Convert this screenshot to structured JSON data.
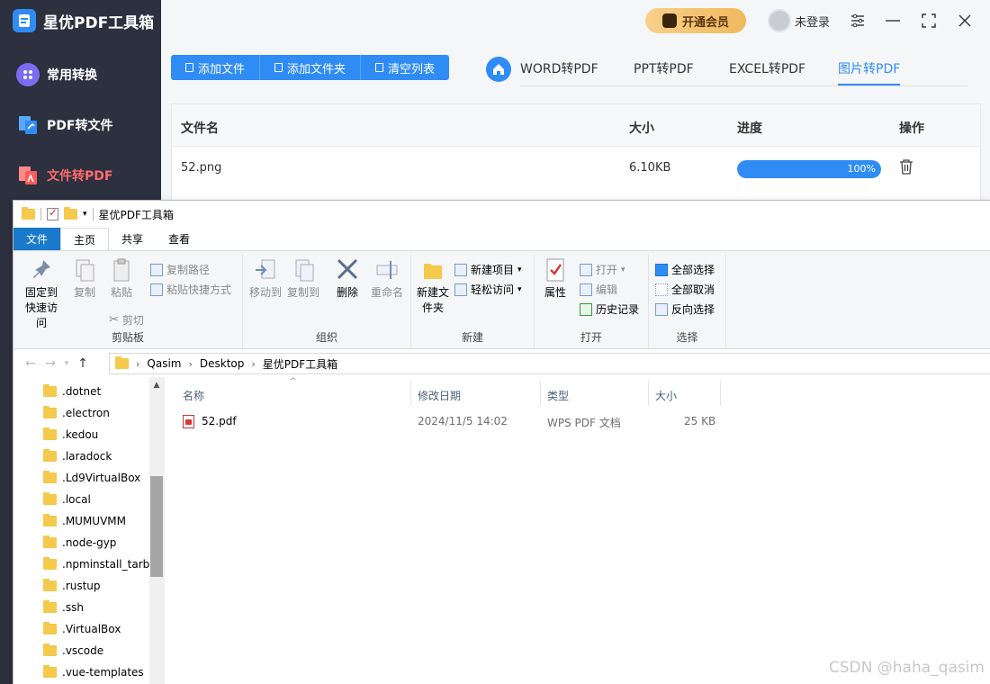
{
  "app": {
    "title": "星优PDF工具箱",
    "sidebar": [
      {
        "label": "常用转换",
        "icon": "grid-icon",
        "color": "#7c6cf2"
      },
      {
        "label": "PDF转文件",
        "icon": "pdf-to-file-icon",
        "color": "#2f8cf5"
      },
      {
        "label": "文件转PDF",
        "icon": "file-to-pdf-icon",
        "color": "#ff6b6b"
      }
    ],
    "vip_label": "开通会员",
    "user_label": "未登录",
    "actions": [
      "添加文件",
      "添加文件夹",
      "清空列表"
    ],
    "tabs": [
      "WORD转PDF",
      "PPT转PDF",
      "EXCEL转PDF",
      "图片转PDF"
    ],
    "active_tab": "图片转PDF",
    "table": {
      "headers": [
        "文件名",
        "大小",
        "进度",
        "操作"
      ],
      "rows": [
        {
          "name": "52.png",
          "size": "6.10KB",
          "progress": 100,
          "progress_label": "100%"
        }
      ]
    },
    "accent_color": "#2f8cf5"
  },
  "explorer": {
    "title": "星优PDF工具箱",
    "ribbon_tabs": [
      "文件",
      "主页",
      "共享",
      "查看"
    ],
    "active_ribbon_tab": "主页",
    "groups": {
      "clipboard": {
        "label": "剪贴板",
        "pin": "固定到快速访问",
        "copy": "复制",
        "paste": "粘贴",
        "copy_path": "复制路径",
        "paste_shortcut": "粘贴快捷方式",
        "cut": "剪切"
      },
      "organize": {
        "label": "组织",
        "move_to": "移动到",
        "copy_to": "复制到",
        "delete": "删除",
        "rename": "重命名"
      },
      "new": {
        "label": "新建",
        "new_folder": "新建文件夹",
        "new_item": "新建项目",
        "easy_access": "轻松访问"
      },
      "open": {
        "label": "打开",
        "properties": "属性",
        "open": "打开",
        "edit": "编辑",
        "history": "历史记录"
      },
      "select": {
        "label": "选择",
        "select_all": "全部选择",
        "select_none": "全部取消",
        "invert": "反向选择"
      }
    },
    "breadcrumb": [
      "Qasim",
      "Desktop",
      "星优PDF工具箱"
    ],
    "nav_folders": [
      ".dotnet",
      ".electron",
      ".kedou",
      ".laradock",
      ".Ld9VirtualBox",
      ".local",
      ".MUMUVMM",
      ".node-gyp",
      ".npminstall_tarba",
      ".rustup",
      ".ssh",
      ".VirtualBox",
      ".vscode",
      ".vue-templates"
    ],
    "columns": [
      "名称",
      "修改日期",
      "类型",
      "大小"
    ],
    "files": [
      {
        "name": "52.pdf",
        "modified": "2024/11/5 14:02",
        "type": "WPS PDF 文档",
        "size": "25 KB"
      }
    ]
  },
  "watermark": "CSDN @haha_qasim"
}
